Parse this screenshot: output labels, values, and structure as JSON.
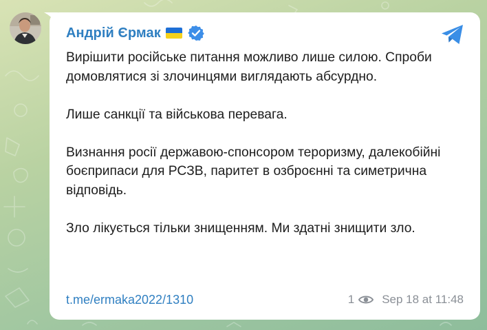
{
  "post": {
    "author": "Андрій Єрмак",
    "paragraphs": [
      "Вирішити російське питання можливо лише силою. Спроби домовлятися зі злочинцями виглядають абсурдно.",
      "Лише санкції та військова перевага.",
      "Визнання росії державою-спонсором тероризму, далекобійні боєприпаси для РСЗВ, паритет в озброєнні та симетрична відповідь.",
      "Зло лікується тільки знищенням. Ми здатні знищити зло."
    ],
    "link": "t.me/ermaka2022/1310",
    "views": "1",
    "timestamp": "Sep 18 at 11:48"
  },
  "icons": {
    "avatar": "avatar",
    "flag": "ukraine-flag-icon",
    "verified": "verified-badge-icon",
    "share": "telegram-share-icon",
    "views": "eye-icon"
  },
  "colors": {
    "accent": "#2f7fc1",
    "verified": "#3d8ee8",
    "share": "#3a8ee6",
    "muted": "#8a8f96"
  }
}
